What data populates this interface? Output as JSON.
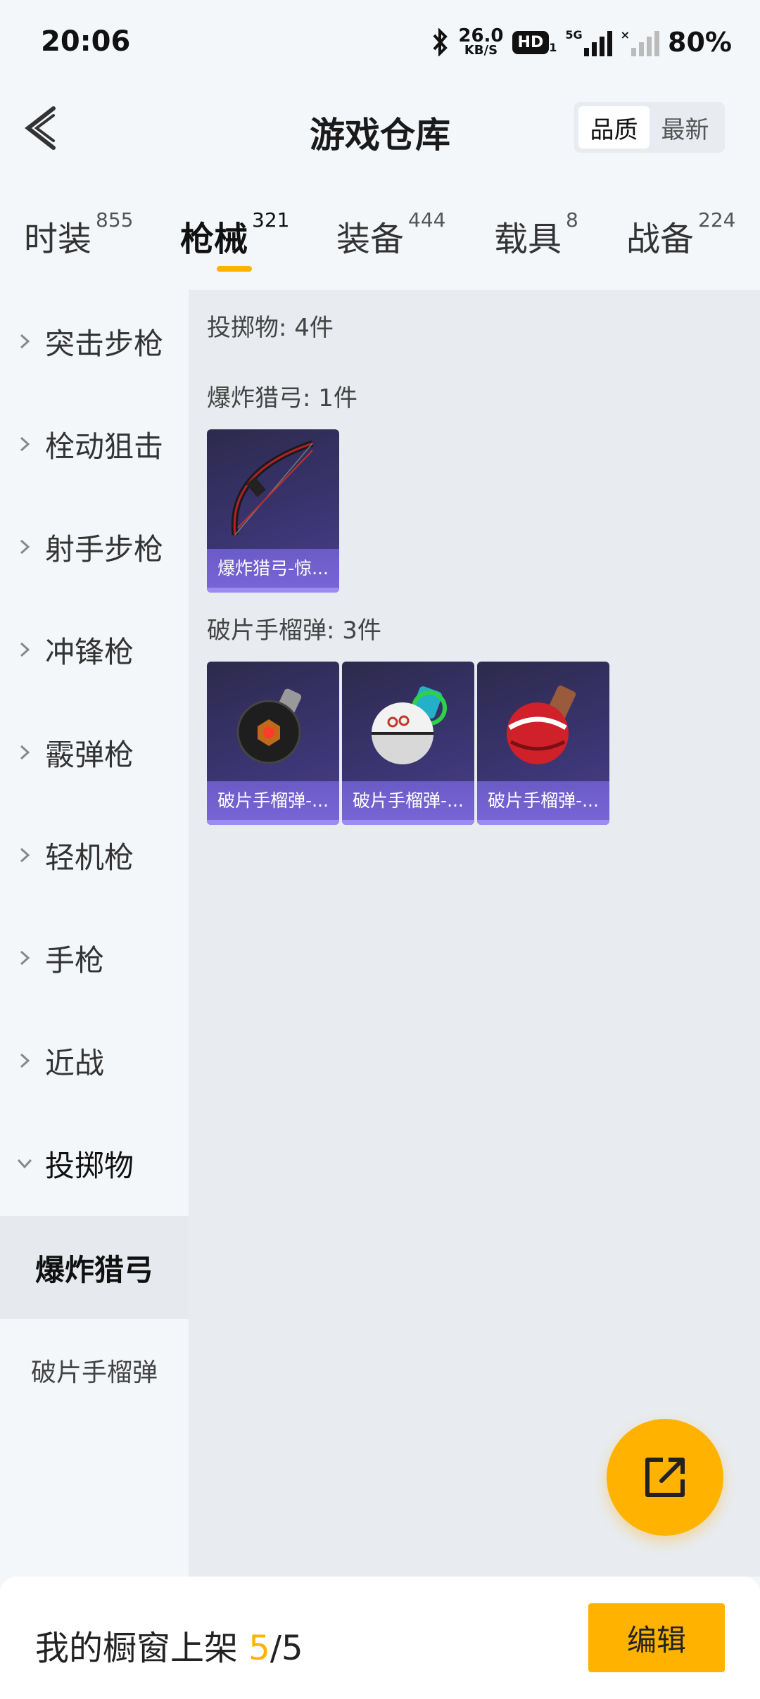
{
  "status_bar": {
    "time": "20:06",
    "net_speed": "26.0",
    "net_unit": "KB/S",
    "hd": "HD",
    "hd_sub": "1",
    "signal": "5G",
    "battery": "80%"
  },
  "header": {
    "title": "游戏仓库",
    "sort_options": [
      "品质",
      "最新"
    ],
    "sort_selected": "品质"
  },
  "tabs": [
    {
      "label": "时装",
      "count": "855"
    },
    {
      "label": "枪械",
      "count": "321",
      "active": true
    },
    {
      "label": "装备",
      "count": "444"
    },
    {
      "label": "载具",
      "count": "8"
    },
    {
      "label": "战备",
      "count": "224"
    }
  ],
  "sidebar": {
    "categories": [
      "突击步枪",
      "栓动狙击",
      "射手步枪",
      "冲锋枪",
      "霰弹枪",
      "轻机枪",
      "手枪",
      "近战",
      "投掷物"
    ],
    "open_category": "投掷物",
    "subitems": [
      "爆炸猎弓",
      "破片手榴弹"
    ],
    "active_subitem": "爆炸猎弓"
  },
  "main": {
    "section_total": "投掷物: 4件",
    "groups": [
      {
        "title": "爆炸猎弓: 1件",
        "items": [
          {
            "name": "爆炸猎弓-惊...",
            "icon": "bow-icon"
          }
        ]
      },
      {
        "title": "破片手榴弹: 3件",
        "items": [
          {
            "name": "破片手榴弹-...",
            "icon": "grenade-black-icon"
          },
          {
            "name": "破片手榴弹-...",
            "icon": "grenade-white-icon"
          },
          {
            "name": "破片手榴弹-...",
            "icon": "grenade-red-icon"
          }
        ]
      }
    ]
  },
  "fab": {
    "icon": "share-icon"
  },
  "bottom": {
    "label": "我的橱窗上架 ",
    "count_current": "5",
    "count_sep": "/",
    "count_total": "5",
    "edit_label": "编辑"
  },
  "colors": {
    "accent": "#ffb300",
    "card_bg": "#3a3470",
    "card_caption": "#7a66d8"
  }
}
